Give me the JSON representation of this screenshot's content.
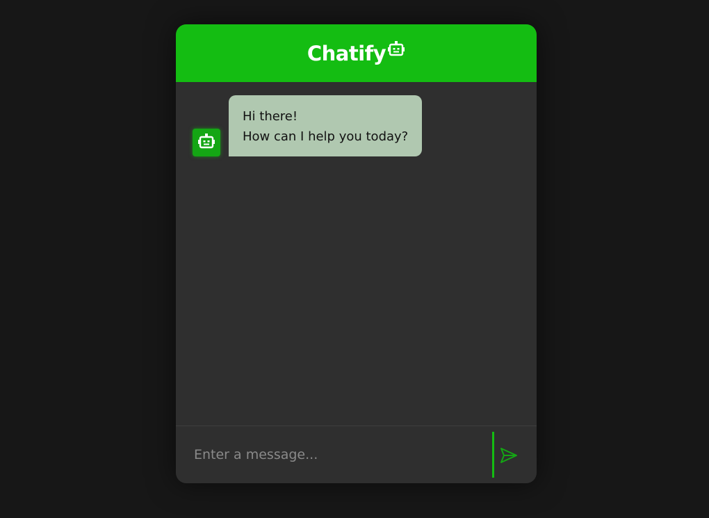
{
  "header": {
    "title": "Chatify",
    "icon": "robot-icon"
  },
  "messages": [
    {
      "sender": "bot",
      "avatar_icon": "robot-icon",
      "lines": [
        "Hi there!",
        "How can I help you today?"
      ]
    }
  ],
  "composer": {
    "placeholder": "Enter a message...",
    "value": "",
    "send_icon": "send-icon"
  },
  "colors": {
    "accent": "#14bd12",
    "background": "#171717",
    "panel": "#2f2f2f",
    "bot_bubble": "#b0c8b0"
  }
}
